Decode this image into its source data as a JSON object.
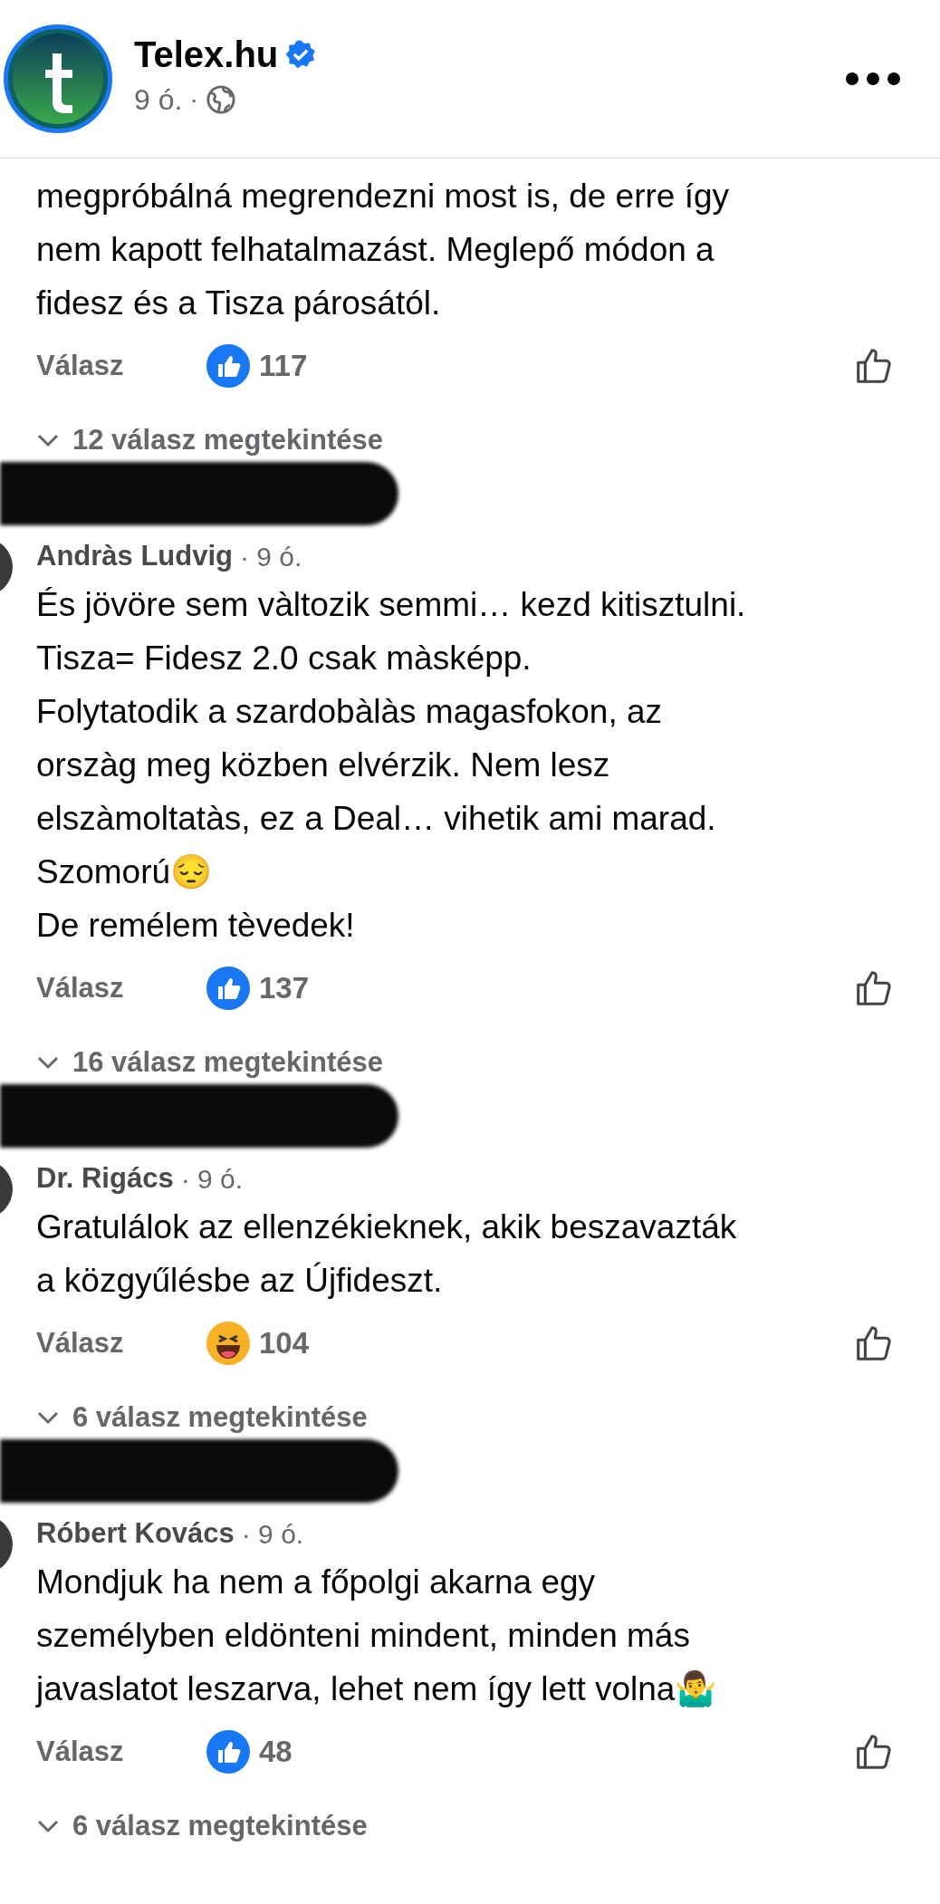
{
  "header": {
    "page_name": "Telex.hu",
    "verified": true,
    "time": "9 ó.",
    "separator": "·"
  },
  "comments": [
    {
      "redacted": false,
      "lines": [
        "megpróbálná megrendezni most is, de erre így",
        "nem kapott felhatalmazást. Meglepő módon a",
        "fidesz és a Tisza párosától."
      ],
      "reply_label": "Válasz",
      "reaction": {
        "kind": "like",
        "count": "117"
      },
      "replies_label": "12 válasz megtekintése"
    },
    {
      "name": "Andràs Ludvig",
      "time": "· 9 ó.",
      "redacted": true,
      "lines": [
        "És jövöre sem vàltozik semmi… kezd kitisztulni.",
        "Tisza= Fidesz 2.0 csak màsképp.",
        "Folytatodik a szardobàlàs magasfokon, az",
        "orszàg meg közben elvérzik. Nem lesz",
        "elszàmoltatàs, ez a Deal… vihetik ami marad.",
        "Szomorú😔",
        "De remélem tèvedek!"
      ],
      "reply_label": "Válasz",
      "reaction": {
        "kind": "like",
        "count": "137"
      },
      "replies_label": "16 válasz megtekintése"
    },
    {
      "name": "Dr. Rigács",
      "time": "· 9 ó.",
      "redacted": true,
      "lines": [
        "Gratulálok az ellenzékieknek, akik beszavazták",
        "a közgyűlésbe az Újfideszt."
      ],
      "reply_label": "Válasz",
      "reaction": {
        "kind": "haha",
        "count": "104"
      },
      "replies_label": "6 válasz megtekintése"
    },
    {
      "name": "Róbert Kovács",
      "time": "· 9 ó.",
      "redacted": true,
      "lines": [
        "Mondjuk ha nem a főpolgi akarna egy",
        "személyben eldönteni mindent, minden más",
        "javaslatot leszarva, lehet nem így lett volna🤷‍♂️"
      ],
      "reply_label": "Válasz",
      "reaction": {
        "kind": "like",
        "count": "48"
      },
      "replies_label": "6 válasz megtekintése"
    }
  ]
}
